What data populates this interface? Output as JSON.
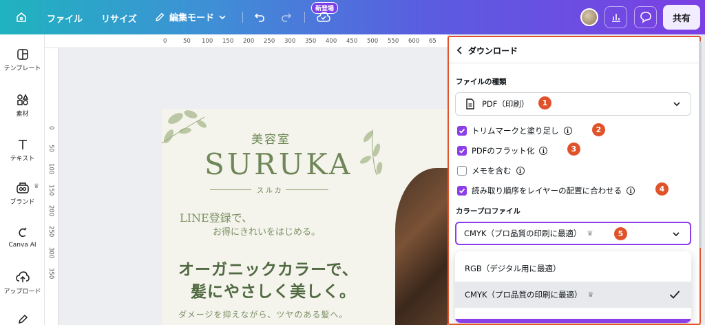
{
  "topbar": {
    "file_label": "ファイル",
    "resize_label": "リサイズ",
    "edit_mode_label": "編集モード",
    "new_badge": "新登場",
    "share_label": "共有"
  },
  "sidebar": {
    "items": [
      {
        "label": "テンプレート",
        "icon": "template-icon"
      },
      {
        "label": "素材",
        "icon": "elements-icon"
      },
      {
        "label": "テキスト",
        "icon": "text-icon"
      },
      {
        "label": "ブランド",
        "icon": "brand-icon"
      },
      {
        "label": "Canva AI",
        "icon": "canva-ai-icon"
      },
      {
        "label": "アップロード",
        "icon": "upload-icon"
      }
    ]
  },
  "rulers": {
    "top": [
      "0",
      "50",
      "100",
      "150",
      "200",
      "250",
      "300",
      "350",
      "400",
      "450",
      "500",
      "550",
      "600",
      "65"
    ],
    "left": [
      "0",
      "50",
      "100",
      "150",
      "200",
      "250",
      "300",
      "350"
    ]
  },
  "design": {
    "salon_sub": "美容室",
    "salon_name": "SURUKA",
    "salon_kana": "スルカ",
    "line_reg_1": "LINE登録で、",
    "line_reg_2": "お得にきれいをはじめる。",
    "headline_1": "オーガニックカラーで、",
    "headline_2": "髪にやさしく美しく。",
    "tagline": "ダメージを抑えながら、ツヤのある髪へ。"
  },
  "download_panel": {
    "title": "ダウンロード",
    "file_type_label": "ファイルの種類",
    "file_type_value": "PDF（印刷）",
    "options": [
      {
        "label": "トリムマークと塗り足し",
        "checked": true,
        "badge": "2"
      },
      {
        "label": "PDFのフラット化",
        "checked": true,
        "badge": "3"
      },
      {
        "label": "メモを含む",
        "checked": false,
        "badge": ""
      },
      {
        "label": "読み取り順序をレイヤーの配置に合わせる",
        "checked": true,
        "badge": "4"
      }
    ],
    "color_profile_label": "カラープロファイル",
    "color_profile_value": "CMYK（プロ品質の印刷に最適）",
    "file_type_badge": "1",
    "color_profile_badge": "5",
    "dropdown_options": [
      {
        "label": "RGB（デジタル用に最適）",
        "selected": false,
        "premium": false
      },
      {
        "label": "CMYK（プロ品質の印刷に最適）",
        "selected": true,
        "premium": true
      }
    ]
  },
  "colors": {
    "accent_purple": "#8b3fe8",
    "highlight_orange": "#e0522a"
  }
}
